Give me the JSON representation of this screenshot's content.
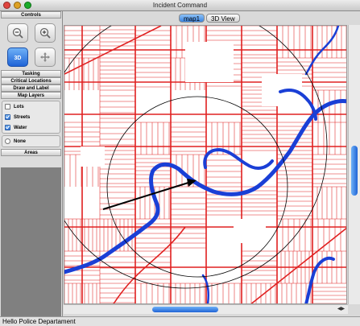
{
  "window": {
    "title": "Incident Command"
  },
  "sidebar": {
    "controls_header": "Controls",
    "tools": [
      {
        "name": "zoom-out",
        "active": false
      },
      {
        "name": "zoom-in",
        "active": false
      },
      {
        "name": "3d",
        "label": "3D",
        "active": true
      },
      {
        "name": "pan",
        "active": false
      }
    ],
    "sections": [
      "Tasking",
      "Critical Locations",
      "Draw and Label",
      "Map Layers"
    ],
    "layers": [
      {
        "label": "Lots",
        "checked": false
      },
      {
        "label": "Streets",
        "checked": true
      },
      {
        "label": "Water",
        "checked": true
      }
    ],
    "none_label": "None",
    "areas_header": "Areas"
  },
  "tabs": [
    {
      "label": "map1",
      "active": true
    },
    {
      "label": "3D View",
      "active": false
    }
  ],
  "map": {
    "street_color": "#e02020",
    "water_color": "#1a3fd6",
    "circle_color": "#000000"
  },
  "status": {
    "text": "Hello Police Departament"
  }
}
